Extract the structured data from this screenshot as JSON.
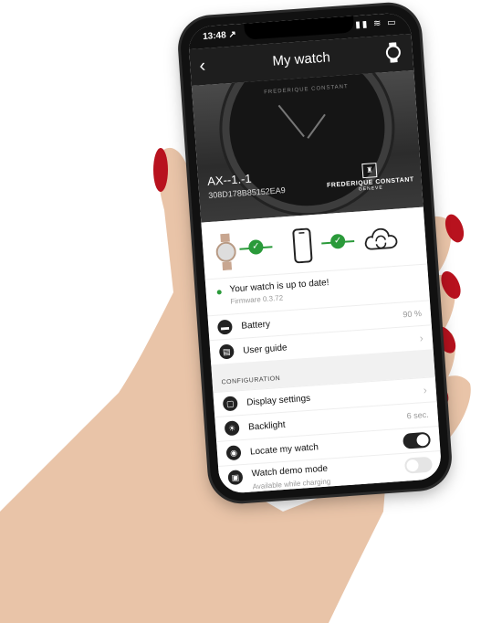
{
  "status_bar": {
    "time": "13:48 ↗",
    "icons": "▮▮ ≋ ▭"
  },
  "nav": {
    "back": "‹",
    "title": "My watch"
  },
  "watch": {
    "model": "AX--1.-1",
    "serial": "308D178B85152EA9",
    "dial_brand": "FREDERIQUE CONSTANT",
    "brand_line1": "FREDERIQUE CONSTANT",
    "brand_line2": "GENEVE"
  },
  "sync": {
    "check1": "✓",
    "check2": "✓",
    "cloud": "⟳"
  },
  "update": {
    "message": "Your watch is up to date!",
    "firmware": "Firmware 0.3.72"
  },
  "rows_top": [
    {
      "label": "Battery",
      "value": "90 %",
      "icon": "▬"
    },
    {
      "label": "User guide",
      "value": "›",
      "icon": "▤"
    }
  ],
  "section_title": "CONFIGURATION",
  "rows_config": [
    {
      "label": "Display settings",
      "value": "›",
      "icon": "▢"
    },
    {
      "label": "Backlight",
      "value": "6 sec.",
      "icon": "☀"
    },
    {
      "label": "Locate my watch",
      "toggle": "on",
      "icon": "◉"
    },
    {
      "label": "Watch demo mode",
      "sub": "Available while charging",
      "toggle": "off",
      "icon": "▣"
    }
  ]
}
